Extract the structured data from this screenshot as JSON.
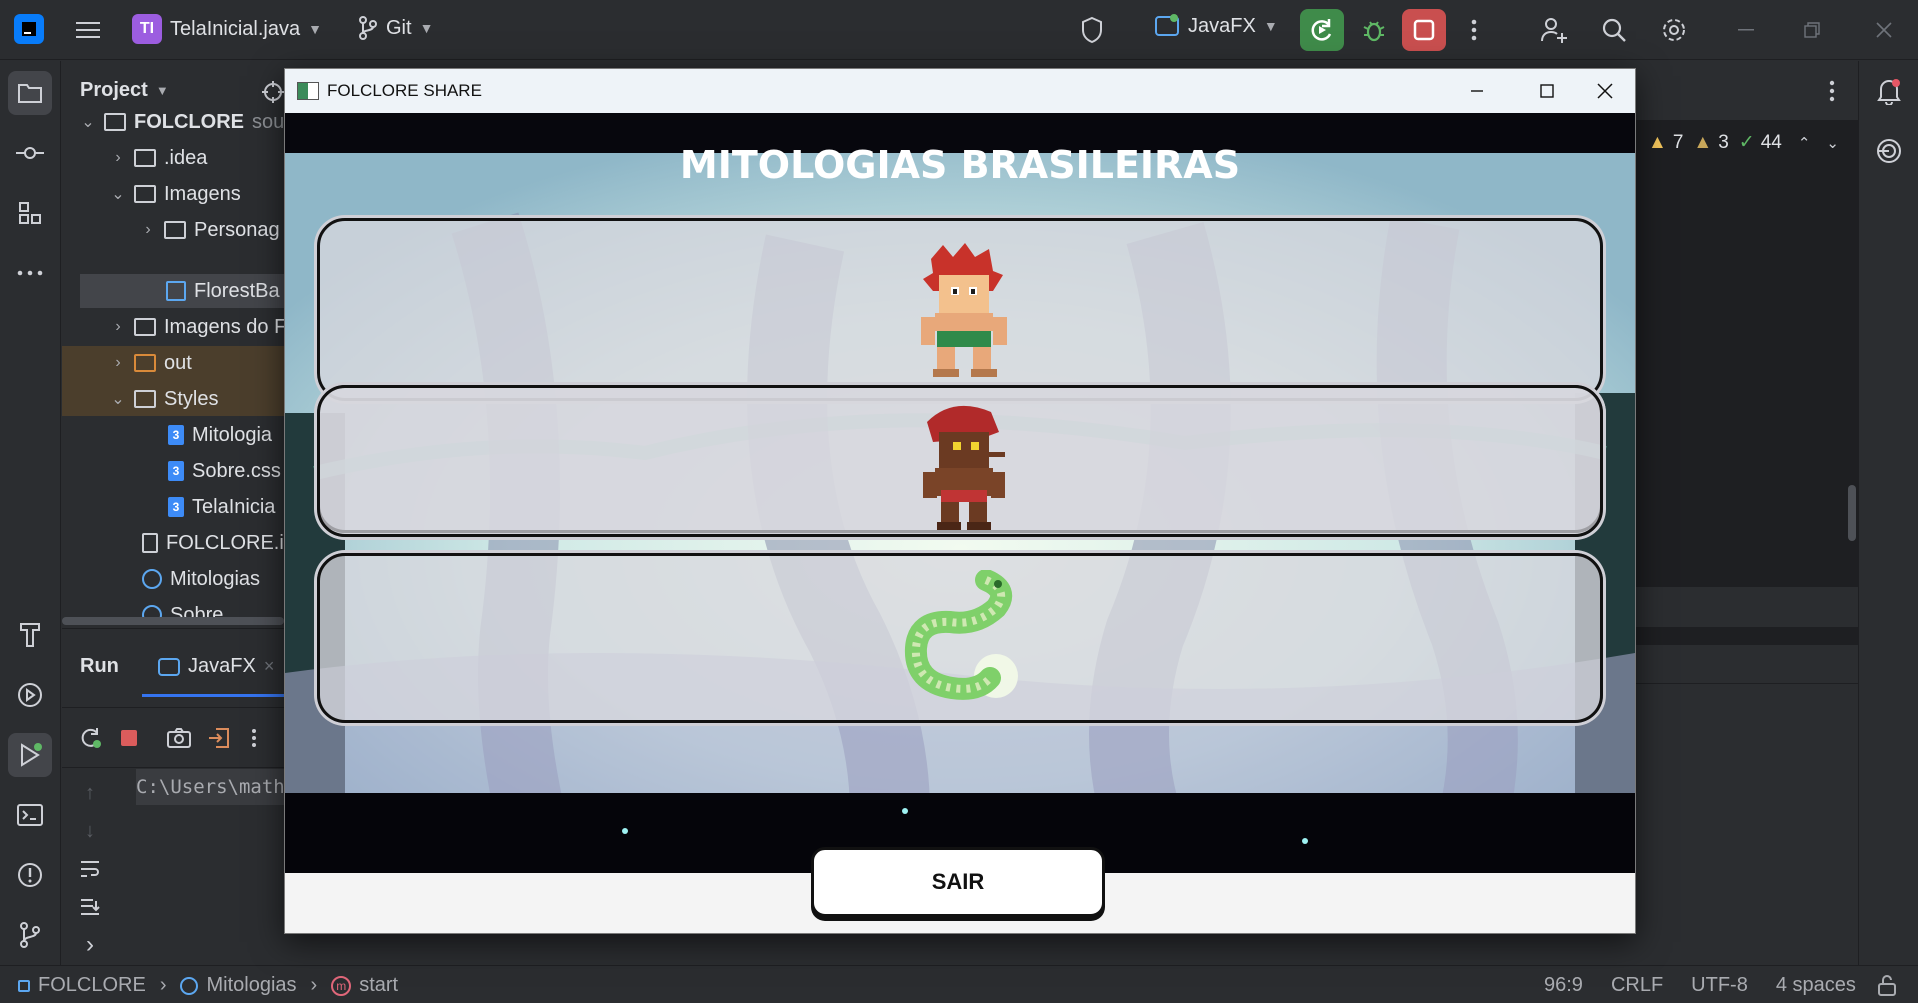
{
  "topbar": {
    "project_badge": "TI",
    "file_name": "TelaInicial.java",
    "vcs_label": "Git",
    "run_config": "JavaFX"
  },
  "project_panel": {
    "title": "Project",
    "tree": [
      {
        "label": "FOLCLORE",
        "suffix": "sou",
        "kind": "root"
      },
      {
        "label": ".idea",
        "kind": "folder"
      },
      {
        "label": "Imagens",
        "kind": "folder"
      },
      {
        "label": "Personag",
        "kind": "folder"
      },
      {
        "label": "FlorestBa",
        "kind": "image"
      },
      {
        "label": "Imagens do F",
        "kind": "folder"
      },
      {
        "label": "out",
        "kind": "folder"
      },
      {
        "label": "Styles",
        "kind": "folder"
      },
      {
        "label": "Mitologia",
        "kind": "css"
      },
      {
        "label": "Sobre.css",
        "kind": "css"
      },
      {
        "label": "TelaInicia",
        "kind": "css"
      },
      {
        "label": "FOLCLORE.i",
        "kind": "file"
      },
      {
        "label": "Mitologias",
        "kind": "java"
      },
      {
        "label": "Sobre",
        "kind": "java"
      }
    ]
  },
  "run_panel": {
    "title": "Run",
    "tab_label": "JavaFX",
    "console_line": "C:\\Users\\math"
  },
  "inspections": {
    "warnings": "7",
    "weak_warnings": "3",
    "ok": "44"
  },
  "statusbar": {
    "breadcrumb": [
      "FOLCLORE",
      "Mitologias",
      "start"
    ],
    "position": "96:9",
    "line_sep": "CRLF",
    "encoding": "UTF-8",
    "indent": "4 spaces"
  },
  "app_window": {
    "title": "FOLCLORE SHARE",
    "heading": "MITOLOGIAS BRASILEIRAS",
    "exit_button": "SAIR"
  },
  "colors": {
    "ide_bg": "#2b2d30",
    "run_green": "#3f8b4a",
    "stop_red": "#c94f4f",
    "badge_purple": "#9c5de0"
  }
}
